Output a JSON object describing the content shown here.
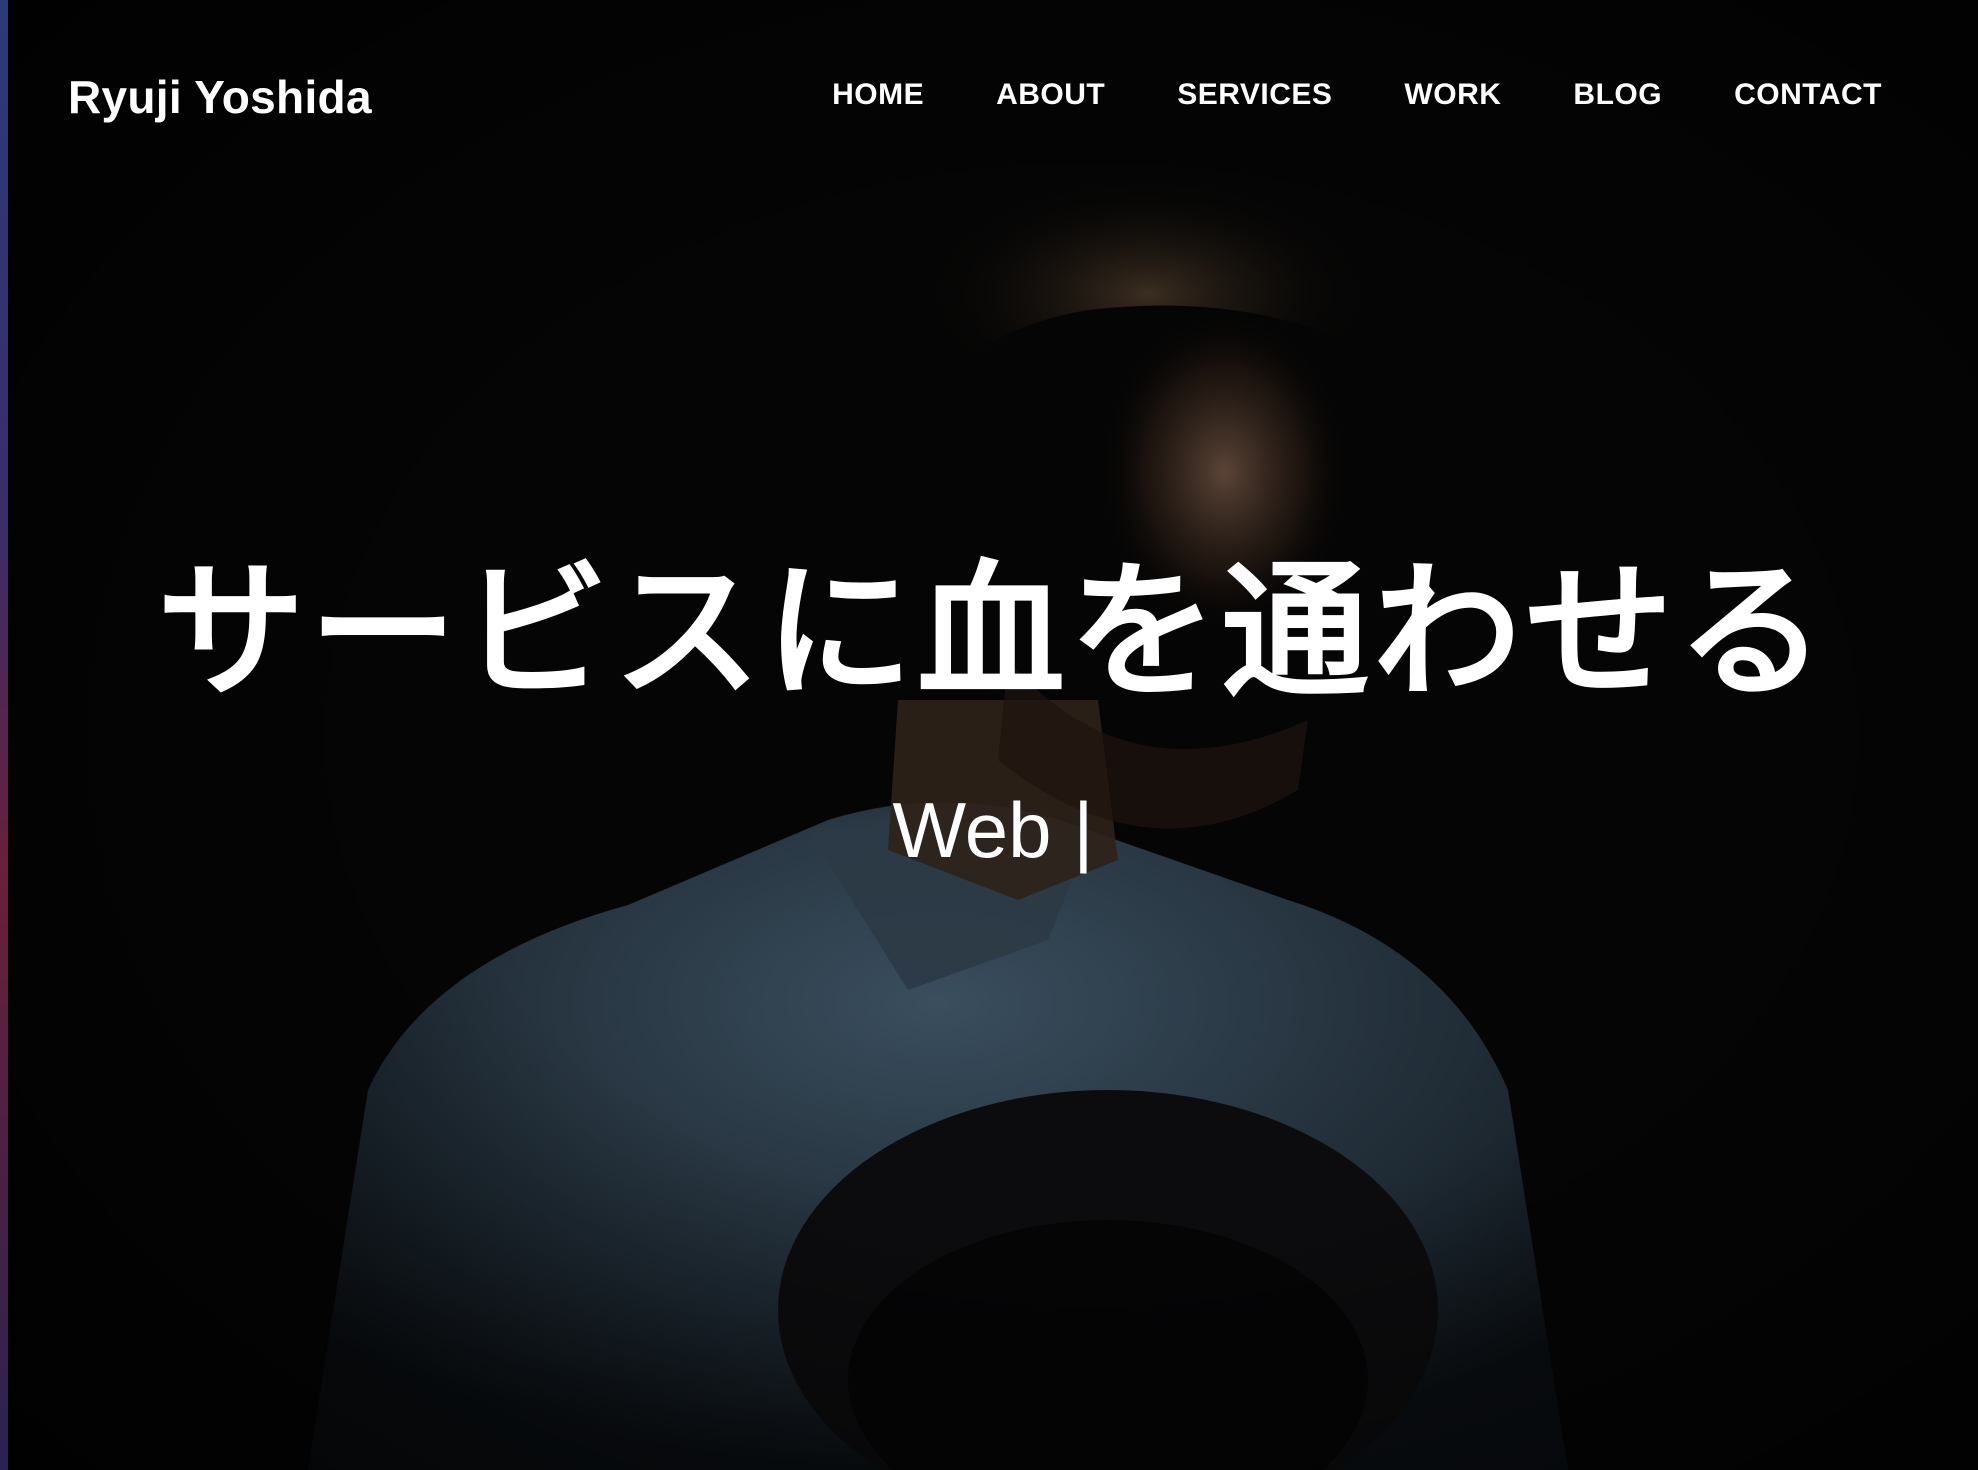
{
  "site": {
    "logo": "Ryuji Yoshida"
  },
  "nav": {
    "items": [
      {
        "label": "HOME"
      },
      {
        "label": "ABOUT"
      },
      {
        "label": "SERVICES"
      },
      {
        "label": "WORK"
      },
      {
        "label": "BLOG"
      },
      {
        "label": "CONTACT"
      }
    ]
  },
  "hero": {
    "headline": "サービスに血を通わせる",
    "typed_text": "Web |",
    "background_image": "dark portrait photo of a man in a denim shirt holding a hat"
  },
  "colors": {
    "text": "#ffffff",
    "background": "#050505",
    "shirt": "#3d5263"
  }
}
